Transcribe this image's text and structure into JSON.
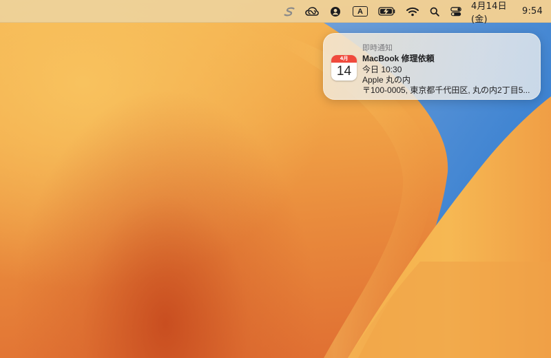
{
  "menubar": {
    "date": "4月14日(金)",
    "time": "9:54",
    "icons": [
      "s-app-icon",
      "creative-cloud-icon",
      "user-circle-icon",
      "input-source-icon",
      "battery-charging-icon",
      "wifi-icon",
      "spotlight-search-icon",
      "control-center-icon"
    ],
    "input_source_letter": "A"
  },
  "notification": {
    "app_label": "即時通知",
    "title": "MacBook 修理依頼",
    "time": "今日 10:30",
    "location": "Apple 丸の内",
    "address": "〒100-0005, 東京都千代田区, 丸の内2丁目5...",
    "calendar_icon": {
      "month": "4月",
      "day": "14",
      "header_color": "#f04a3c"
    }
  },
  "wallpaper": {
    "colors": [
      "#f6b955",
      "#ef9b44",
      "#df6c31",
      "#4a8fd6"
    ]
  }
}
